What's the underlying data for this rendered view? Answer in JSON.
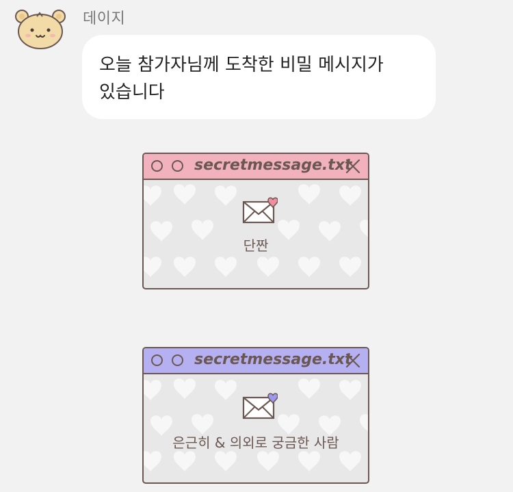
{
  "chat": {
    "sender_name": "데이지",
    "message_text": "오늘 참가자님께 도착한 비밀 메시지가 있습니다"
  },
  "cards": [
    {
      "title": "secretmessage.txt",
      "caption": "단짠",
      "accent": "#f2b2bd",
      "heart": "#f08ea0"
    },
    {
      "title": "secretmessage.txt",
      "caption": "은근히 & 의외로 궁금한 사람",
      "accent": "#b4b0f2",
      "heart": "#9d97ee"
    }
  ],
  "icons": {
    "avatar": "bear-avatar-icon",
    "window_dots": "circle-icon",
    "close": "close-icon",
    "message": "envelope-heart-icon"
  },
  "colors": {
    "background": "#f2f2f2",
    "outline": "#6b5751",
    "bubble": "#ffffff"
  }
}
